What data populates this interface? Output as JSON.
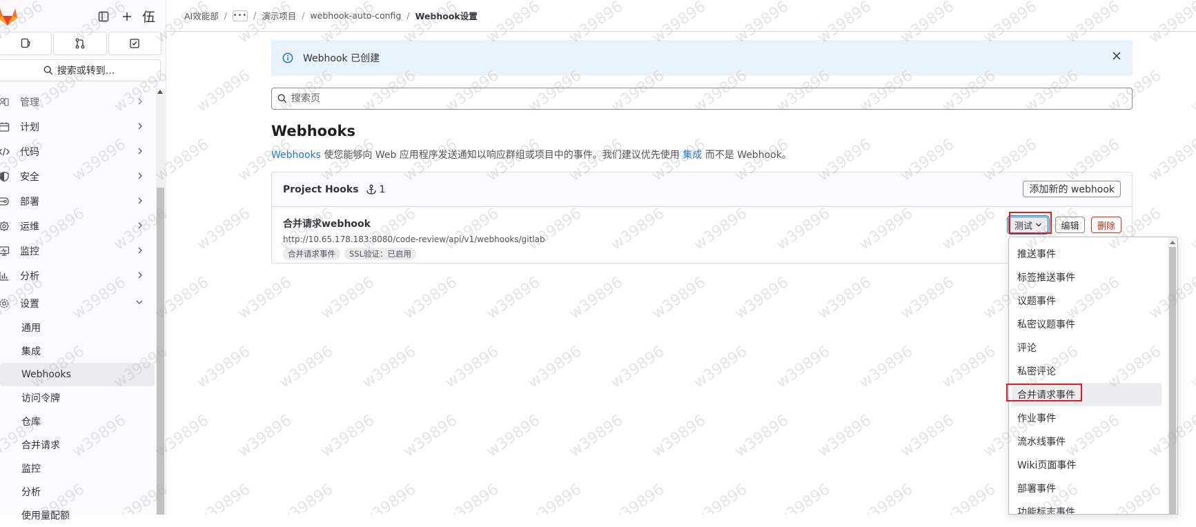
{
  "sidebar": {
    "avatar_text": "伍",
    "search_label": "搜索或转到...",
    "items": [
      {
        "label": "管理",
        "icon": "users-icon"
      },
      {
        "label": "计划",
        "icon": "calendar-icon"
      },
      {
        "label": "代码",
        "icon": "code-icon"
      },
      {
        "label": "安全",
        "icon": "shield-icon"
      },
      {
        "label": "部署",
        "icon": "deploy-icon"
      },
      {
        "label": "运维",
        "icon": "operations-icon"
      },
      {
        "label": "监控",
        "icon": "monitor-icon"
      },
      {
        "label": "分析",
        "icon": "chart-icon"
      },
      {
        "label": "设置",
        "icon": "gear-icon"
      }
    ],
    "settings_sub": [
      "通用",
      "集成",
      "Webhooks",
      "访问令牌",
      "仓库",
      "合并请求",
      "监控",
      "分析",
      "使用量配额"
    ]
  },
  "breadcrumb": {
    "group": "AI效能部",
    "more": "•••",
    "project": "演示项目",
    "repo": "webhook-auto-config",
    "current": "Webhook设置"
  },
  "alert": {
    "text": "Webhook 已创建"
  },
  "search": {
    "placeholder": "搜索页"
  },
  "page": {
    "title": "Webhooks",
    "desc_link1": "Webhooks",
    "desc_mid": " 使您能够向 Web 应用程序发送通知以响应群组或项目中的事件。我们建议优先使用 ",
    "desc_link2": "集成",
    "desc_end": " 而不是 Webhook。"
  },
  "hooks": {
    "title": "Project Hooks",
    "count": "1",
    "add_button": "添加新的 webhook",
    "item": {
      "name": "合并请求webhook",
      "url": "http://10.65.178.183:8080/code-review/api/v1/webhooks/gitlab",
      "badges": [
        "合并请求事件",
        "SSL验证：已启用"
      ],
      "test_label": "测试",
      "edit_label": "编辑",
      "delete_label": "删除"
    }
  },
  "dropdown": {
    "items": [
      "推送事件",
      "标签推送事件",
      "议题事件",
      "私密议题事件",
      "评论",
      "私密评论",
      "合并请求事件",
      "作业事件",
      "流水线事件",
      "Wiki页面事件",
      "部署事件",
      "功能标志事件"
    ],
    "highlighted_index": 6
  },
  "watermark": "w39896"
}
